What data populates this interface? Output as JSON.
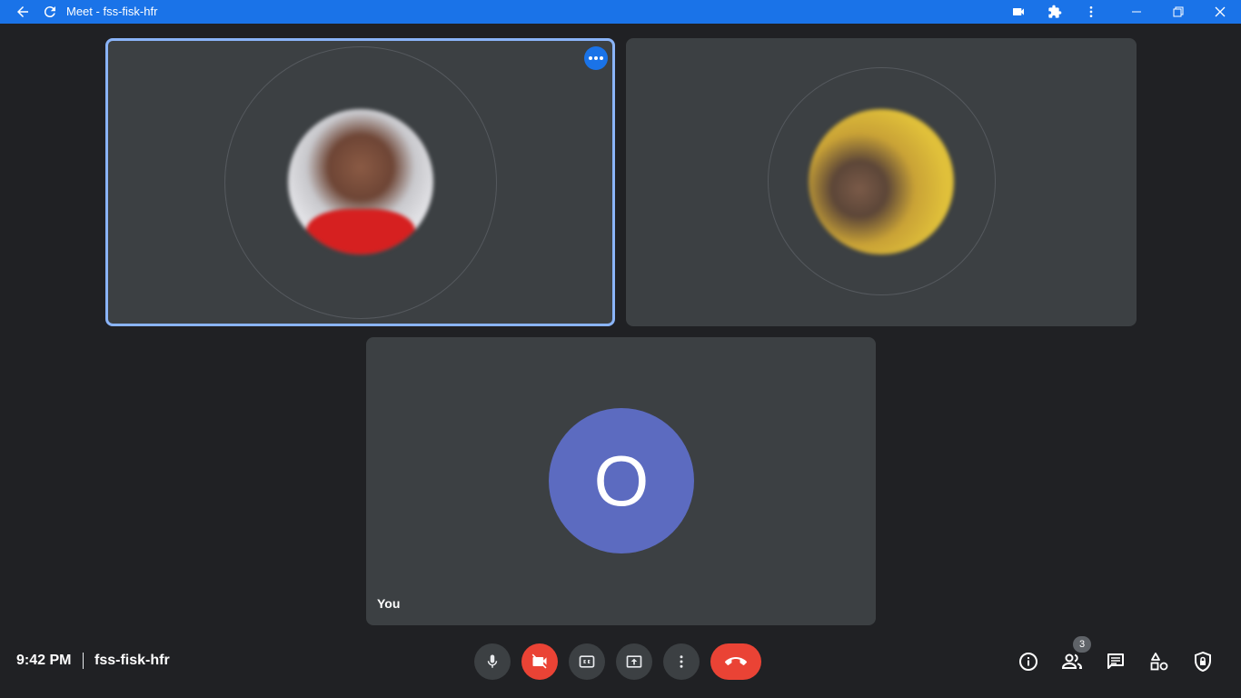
{
  "titlebar": {
    "title": "Meet - fss-fisk-hfr",
    "icons": [
      "back-arrow-icon",
      "reload-icon",
      "camera-icon",
      "extensions-icon",
      "more-vert-icon",
      "minimize-icon",
      "restore-icon",
      "close-icon"
    ]
  },
  "tiles": {
    "self_label": "You",
    "self_initial": "O",
    "self_avatar_color": "#5c6bc0",
    "active_border_color": "#8ab4f8"
  },
  "footer": {
    "time": "9:42 PM",
    "meeting_code": "fss-fisk-hfr",
    "participant_count": "3"
  },
  "colors": {
    "accent": "#1a73e8",
    "background": "#202124",
    "tile": "#3c4043",
    "danger": "#ea4335"
  }
}
